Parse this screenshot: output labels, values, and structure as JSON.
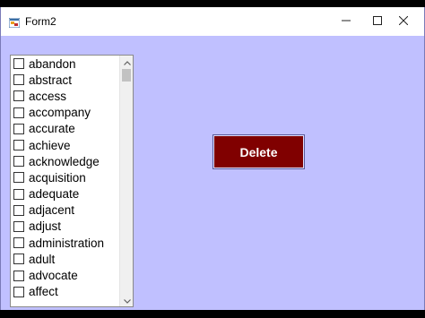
{
  "window": {
    "title": "Form2",
    "controls": {
      "minimize": "minimize-icon",
      "maximize": "maximize-icon",
      "close": "close-icon"
    },
    "background_color": "#c0c0ff"
  },
  "listbox": {
    "items": [
      {
        "label": "abandon",
        "checked": false
      },
      {
        "label": "abstract",
        "checked": false
      },
      {
        "label": "access",
        "checked": false
      },
      {
        "label": "accompany",
        "checked": false
      },
      {
        "label": "accurate",
        "checked": false
      },
      {
        "label": "achieve",
        "checked": false
      },
      {
        "label": "acknowledge",
        "checked": false
      },
      {
        "label": "acquisition",
        "checked": false
      },
      {
        "label": "adequate",
        "checked": false
      },
      {
        "label": "adjacent",
        "checked": false
      },
      {
        "label": "adjust",
        "checked": false
      },
      {
        "label": "administration",
        "checked": false
      },
      {
        "label": "adult",
        "checked": false
      },
      {
        "label": "advocate",
        "checked": false
      },
      {
        "label": "affect",
        "checked": false
      }
    ],
    "scrollbar": {
      "up_icon": "chevron-up-icon",
      "down_icon": "chevron-down-icon"
    }
  },
  "delete_button": {
    "label": "Delete",
    "background_color": "#800000"
  }
}
